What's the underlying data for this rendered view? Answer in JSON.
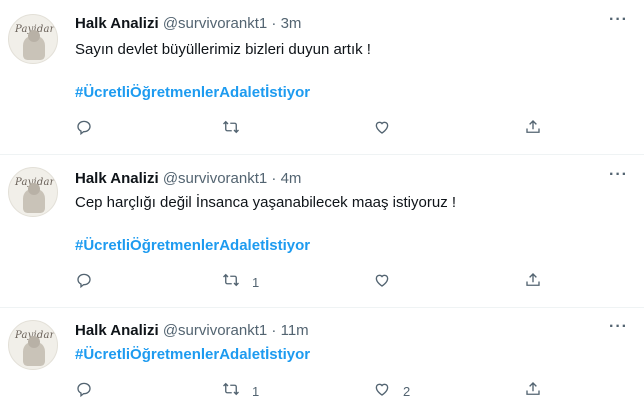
{
  "tweets": [
    {
      "name": "Halk Analizi",
      "handle": "@survivorankt1",
      "separator": "·",
      "time": "3m",
      "text": "Sayın devlet büyüllerimiz bizleri duyun artık !",
      "hashtag": "#ÜcretliÖğretmenlerAdaletİstiyor",
      "replies": "",
      "retweets": "",
      "likes": ""
    },
    {
      "name": "Halk Analizi",
      "handle": "@survivorankt1",
      "separator": "·",
      "time": "4m",
      "text": "Cep harçlığı değil İnsanca yaşanabilecek maaş istiyoruz !",
      "hashtag": "#ÜcretliÖğretmenlerAdaletİstiyor",
      "replies": "",
      "retweets": "1",
      "likes": ""
    },
    {
      "name": "Halk Analizi",
      "handle": "@survivorankt1",
      "separator": "·",
      "time": "11m",
      "text": "",
      "hashtag": "#ÜcretliÖğretmenlerAdaletİstiyor",
      "replies": "",
      "retweets": "1",
      "likes": "2"
    }
  ],
  "avatar_logo": "Payidar",
  "more_glyph": "···",
  "icons": [
    "reply-icon",
    "retweet-icon",
    "like-icon",
    "share-icon",
    "more-icon"
  ],
  "colors": {
    "hashtag": "#1d9bf0",
    "meta": "#536471",
    "text": "#0f1419",
    "divider": "#eff3f4"
  }
}
